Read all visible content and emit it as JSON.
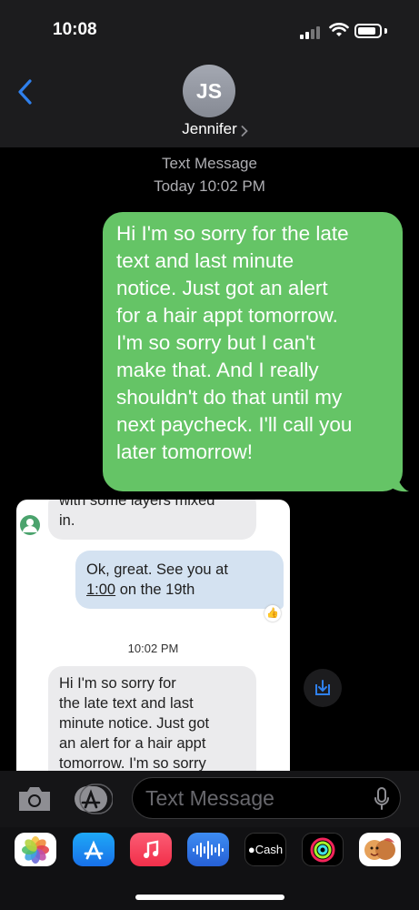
{
  "status_bar": {
    "time": "10:08"
  },
  "header": {
    "avatar_initials": "JS",
    "contact_name": "Jennifer"
  },
  "thread": {
    "service_label": "Text Message",
    "timestamp": "Today 10:02 PM",
    "sent_message_lines": [
      "Hi I'm so sorry for the late",
      "text and last minute",
      "notice. Just got an alert",
      "for a hair appt tomorrow.",
      "I'm so sorry but I can't",
      "make that. And I really",
      "shouldn't do that until my",
      "next paycheck. I'll call you",
      "later tomorrow!"
    ],
    "sent_bubble_color": "#65c466"
  },
  "attachment": {
    "prev_message_cutoff": "with some layers mixed",
    "prev_message_end": "in.",
    "sent_line1": "Ok, great. See you at",
    "sent_time_link": "1:00",
    "sent_line2_rest": " on the 19th",
    "reaction_icon": "thumbs-up",
    "time_label": "10:02 PM",
    "recv_lines": [
      "Hi I'm so sorry for",
      "the late text and last",
      "minute notice. Just got",
      "an alert for a hair appt",
      "tomorrow. I'm so sorry"
    ]
  },
  "input": {
    "placeholder": "Text Message"
  },
  "app_drawer": {
    "apps": [
      "photos-icon",
      "app-store-icon",
      "music-icon",
      "audio-message-icon",
      "apple-cash-icon",
      "activity-icon",
      "memoji-icon"
    ],
    "cash_label": "Cash"
  }
}
